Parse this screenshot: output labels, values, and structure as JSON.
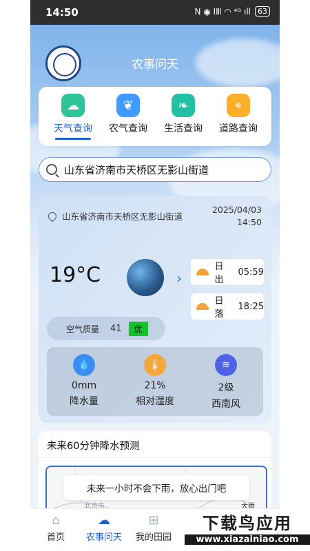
{
  "statusbar": {
    "time": "14:50",
    "icons": "N ◉ ⅠⅢ ◠ ⁴ᴳ ıll",
    "battery": "63"
  },
  "header": {
    "title": "农事问天"
  },
  "tabs": [
    {
      "label": "天气查询",
      "icon": "cloud-icon",
      "color": "#2fc39a",
      "active": true
    },
    {
      "label": "农气查询",
      "icon": "sprout-icon",
      "color": "#3f9bff",
      "active": false
    },
    {
      "label": "生活查询",
      "icon": "leaf-icon",
      "color": "#22c1a4",
      "active": false
    },
    {
      "label": "道路查询",
      "icon": "map-pin-icon",
      "color": "#ffae2a",
      "active": false
    }
  ],
  "search": {
    "value": "山东省济南市天桥区无影山街道"
  },
  "weather": {
    "location": "山东省济南市天桥区无影山街道",
    "date": "2025/04/03",
    "time": "14:50",
    "temperature": "19°C",
    "sunrise_label": "日出",
    "sunrise": "05:59",
    "sunset_label": "日落",
    "sunset": "18:25",
    "aqi_label": "空气质量",
    "aqi_value": "41",
    "aqi_level": "优",
    "stats": [
      {
        "value": "0mm",
        "label": "降水量",
        "icon": "raindrop-icon",
        "color": "#3b8df5"
      },
      {
        "value": "21%",
        "label": "相对湿度",
        "icon": "thermometer-icon",
        "color": "#f4a83b"
      },
      {
        "value": "2级",
        "label": "西南风",
        "icon": "wind-icon",
        "color": "#4f63e8"
      }
    ]
  },
  "forecast": {
    "title": "未来60分钟降水预测",
    "message": "未来一小时不会下雨，放心出门吧",
    "map_label": "大雨",
    "map_city": "北京市"
  },
  "nav": [
    {
      "label": "首页",
      "icon": "home-icon",
      "active": false
    },
    {
      "label": "农事问天",
      "icon": "weather-chart-icon",
      "active": true
    },
    {
      "label": "我的田园",
      "icon": "field-icon",
      "active": false
    },
    {
      "label": "",
      "icon": "more-icon",
      "active": false
    }
  ],
  "watermark": {
    "main": "下载鸟应用",
    "sub": "www.xiazainiao.com"
  }
}
